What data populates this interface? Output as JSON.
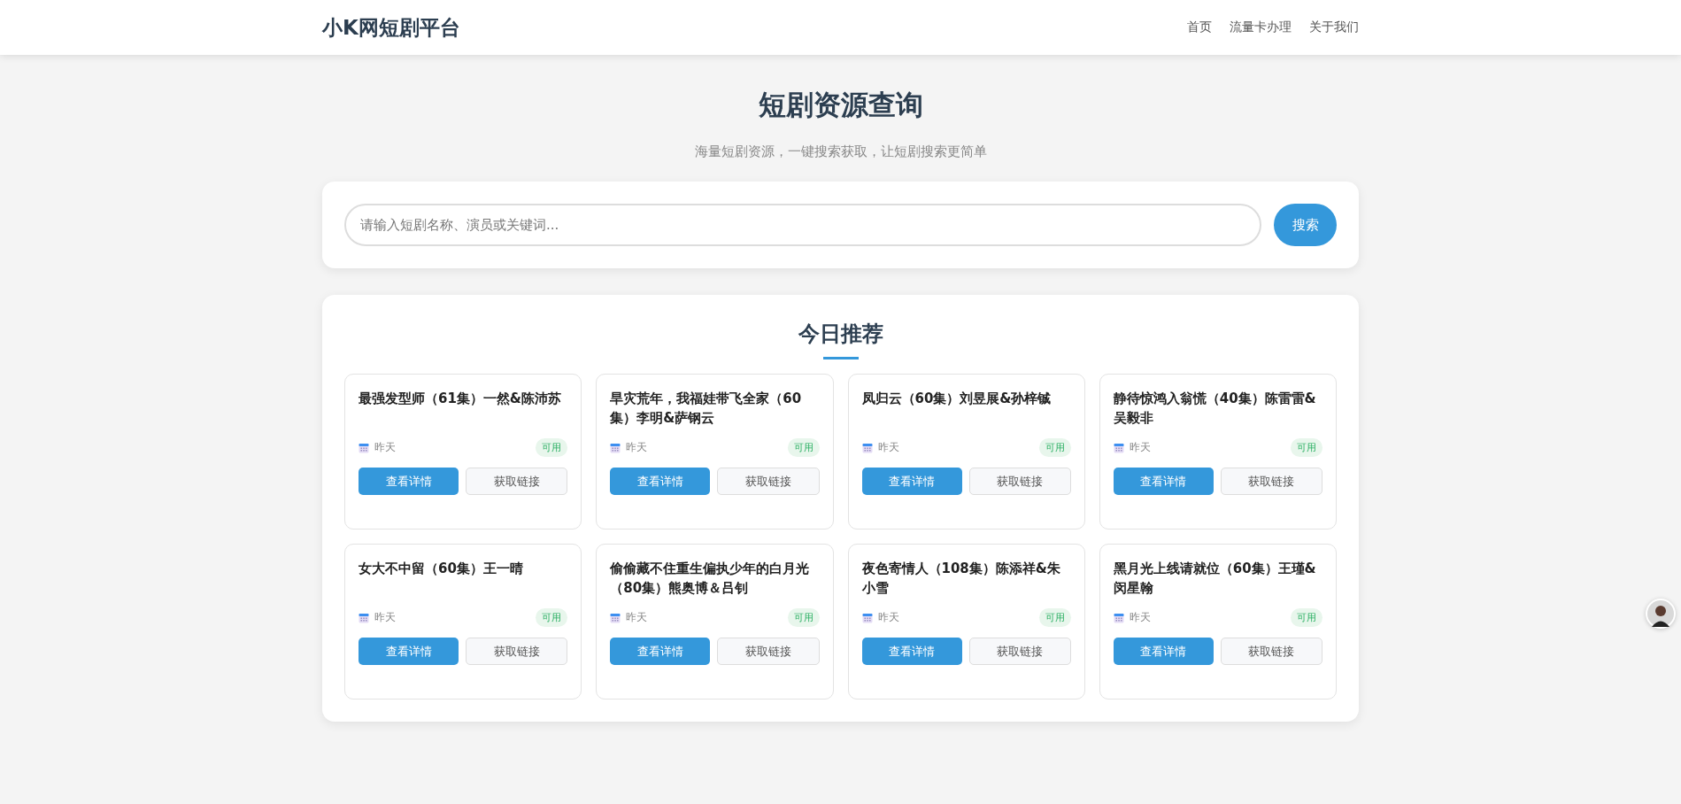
{
  "header": {
    "logo": "小K网短剧平台",
    "nav": [
      "首页",
      "流量卡办理",
      "关于我们"
    ]
  },
  "hero": {
    "title": "短剧资源查询",
    "subtitle": "海量短剧资源，一键搜索获取，让短剧搜索更简单"
  },
  "search": {
    "placeholder": "请输入短剧名称、演员或关键词...",
    "button": "搜索"
  },
  "recommend": {
    "title": "今日推荐",
    "items": [
      {
        "title": "最强发型师（61集）一然&陈沛苏",
        "date": "昨天",
        "status": "可用",
        "primary": "查看详情",
        "secondary": "获取链接"
      },
      {
        "title": "旱灾荒年，我福娃带飞全家（60集）李明&萨钢云",
        "date": "昨天",
        "status": "可用",
        "primary": "查看详情",
        "secondary": "获取链接"
      },
      {
        "title": "凤归云（60集）刘昱展&孙梓铖",
        "date": "昨天",
        "status": "可用",
        "primary": "查看详情",
        "secondary": "获取链接"
      },
      {
        "title": "静待惊鸿入翁慌（40集）陈雷雷&吴毅非",
        "date": "昨天",
        "status": "可用",
        "primary": "查看详情",
        "secondary": "获取链接"
      },
      {
        "title": "女大不中留（60集）王一晴",
        "date": "昨天",
        "status": "可用",
        "primary": "查看详情",
        "secondary": "获取链接"
      },
      {
        "title": "偷偷藏不住重生偏执少年的白月光（80集）熊奥博＆吕钊",
        "date": "昨天",
        "status": "可用",
        "primary": "查看详情",
        "secondary": "获取链接"
      },
      {
        "title": "夜色寄情人（108集）陈添祥&朱小雪",
        "date": "昨天",
        "status": "可用",
        "primary": "查看详情",
        "secondary": "获取链接"
      },
      {
        "title": "黑月光上线请就位（60集）王瑾&闵星翰",
        "date": "昨天",
        "status": "可用",
        "primary": "查看详情",
        "secondary": "获取链接"
      }
    ]
  }
}
